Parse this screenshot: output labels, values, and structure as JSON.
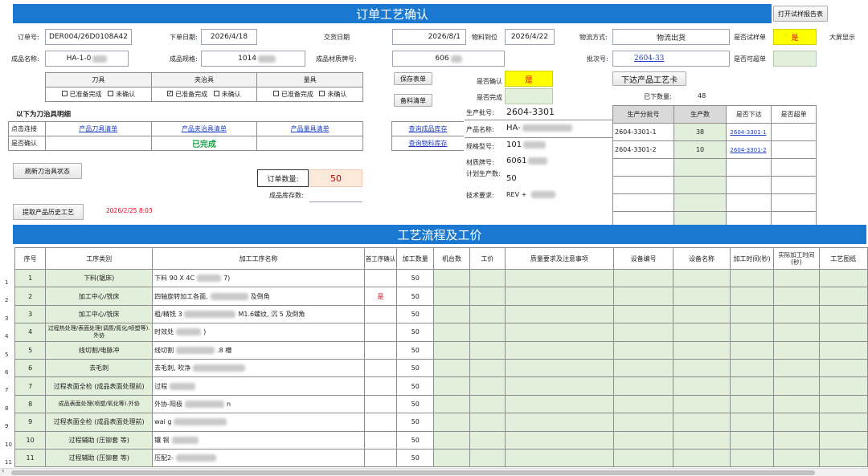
{
  "header": {
    "title": "订单工艺确认",
    "open_report_btn": "打开试样报告表"
  },
  "form": {
    "order_no_label": "订单号:",
    "order_no": "DER004/26D0108A42",
    "order_date_label": "下单日期:",
    "order_date": "2026/4/18",
    "delivery_date_label": "交货日期",
    "delivery_date": "2026/8/1",
    "material_arrival_label": "物料到位",
    "material_arrival": "2026/4/22",
    "logistics_label": "物流方式:",
    "logistics": "物流出货",
    "is_sample_label": "是否试样单",
    "is_sample": "是",
    "big_screen_label": "大屏显示",
    "product_name_label": "成品名称:",
    "product_name": "HA-1-0",
    "product_spec_label": "成品规格:",
    "product_spec": "1014",
    "material_grade_label": "成品材质牌号:",
    "material_grade": "606",
    "batch_no_label": "批次号:",
    "batch_no": "2604-33",
    "can_exceed_label": "是否可超单"
  },
  "tooling": {
    "headers": [
      "刀具",
      "夹治具",
      "量具"
    ],
    "ready": "已准备完成",
    "unconfirmed": "未确认",
    "section_title": "以下为刀治具明细",
    "link_row_label": "点击连接",
    "links": [
      "产品刀具清单",
      "产品夹治具清单",
      "产品量具清单"
    ],
    "confirm_row_label": "是否确认",
    "confirm_status": "已完成"
  },
  "mid": {
    "save_btn": "保存表单",
    "prep_btn": "备料清单",
    "confirm_label": "是否确认",
    "confirm_value": "是",
    "done_label": "是否完成",
    "query_product_stock": "查询成品库存",
    "query_material_stock": "查询物料库存",
    "order_qty_label": "订单数量:",
    "order_qty": "50",
    "stock_label": "成品库存数:"
  },
  "info": {
    "issue_btn": "下达产品工艺卡",
    "issued_qty_label": "已下数量:",
    "issued_qty": "48",
    "prod_batch_label": "生产批号:",
    "prod_batch": "2604-3301",
    "product_name_label": "产品名称:",
    "product_name": "HA-",
    "spec_label": "规格型号:",
    "spec": "101",
    "material_label": "材质牌号:",
    "material": "6061",
    "plan_qty_label": "计划生产数:",
    "plan_qty": "50",
    "tech_req_label": "技术要求:",
    "tech_req": "REV +"
  },
  "split_table": {
    "headers": [
      "生产分批号",
      "生产数",
      "是否下达",
      "是否超单"
    ],
    "rows": [
      {
        "batch": "2604-3301-1",
        "qty": "38",
        "issued": "2604-3301-1"
      },
      {
        "batch": "2604-3301-2",
        "qty": "10",
        "issued": "2604-3301-2"
      }
    ]
  },
  "actions": {
    "refresh_btn": "刷新刀治具状态",
    "history_btn": "提取产品历史工艺",
    "timestamp": "2026/2/25 8:03"
  },
  "process": {
    "title": "工艺流程及工价",
    "headers": [
      "序号",
      "工序类别",
      "加工工序名称",
      "首工序确认",
      "加工数量",
      "机台数",
      "工价",
      "质量要求及注意事项",
      "设备编号",
      "设备名称",
      "加工时间(秒)",
      "实际加工时间(秒)",
      "工艺图纸"
    ],
    "rows": [
      {
        "seq": "1",
        "cat": "下料(锯床)",
        "name": "下料 90 X 4C",
        "tail": "7)",
        "first": "",
        "qty": "50"
      },
      {
        "seq": "2",
        "cat": "加工中心/铣床",
        "name": "四轴旋转加工各面,",
        "tail": "及倒角",
        "first": "是",
        "qty": "50"
      },
      {
        "seq": "3",
        "cat": "加工中心/铣床",
        "name": "粗/精铣 3",
        "tail": "M1.6螺纹, 沉 5 及倒角",
        "first": "",
        "qty": "50"
      },
      {
        "seq": "4",
        "cat": "过程热处理/表面处理(调质/氮化/喷塑等).外协",
        "name": "时效处",
        "tail": ")",
        "first": "",
        "qty": "50"
      },
      {
        "seq": "5",
        "cat": "线切割/电脉冲",
        "name": "线切割",
        "tail": ".8 槽",
        "first": "",
        "qty": "50"
      },
      {
        "seq": "6",
        "cat": "去毛刺",
        "name": "去毛刺, 吹净",
        "tail": "",
        "first": "",
        "qty": "50"
      },
      {
        "seq": "7",
        "cat": "过程表面全检 (成品表面处理前)",
        "name": "过程",
        "tail": "",
        "first": "",
        "qty": "50"
      },
      {
        "seq": "8",
        "cat": "成品表面处理(喷塑/氧化等).外协",
        "name": "外协-阳极",
        "tail": "n",
        "first": "",
        "qty": "50"
      },
      {
        "seq": "9",
        "cat": "过程表面全检 (成品表面处理前)",
        "name": "wai g",
        "tail": "",
        "first": "",
        "qty": "50"
      },
      {
        "seq": "10",
        "cat": "过程辅助 (压铆套 等)",
        "name": "镶 铜",
        "tail": "",
        "first": "",
        "qty": "50"
      },
      {
        "seq": "11",
        "cat": "过程辅助 (压铆套 等)",
        "name": "压配2-",
        "tail": "",
        "first": "",
        "qty": "50"
      }
    ]
  },
  "colors": {
    "bar": "#1a78d0",
    "yellow": "#ffff00",
    "green_fill": "#e2efda",
    "pink_fill": "#fde9d9",
    "red": "#e8001c",
    "green_text": "#1aa34a"
  }
}
